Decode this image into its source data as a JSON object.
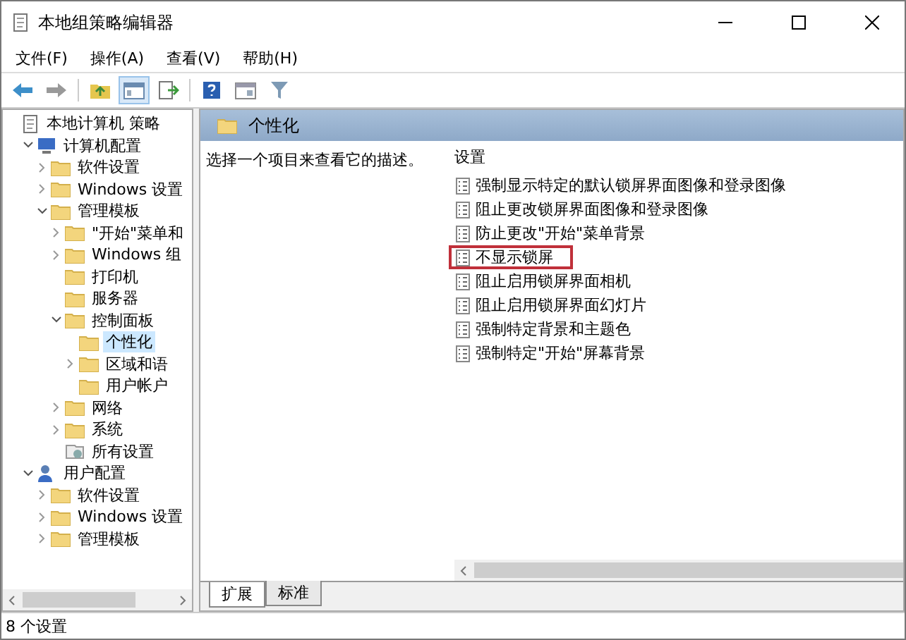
{
  "window": {
    "title": "本地组策略编辑器"
  },
  "menu": [
    "文件(F)",
    "操作(A)",
    "查看(V)",
    "帮助(H)"
  ],
  "toolbar": [
    {
      "kind": "back"
    },
    {
      "kind": "forward"
    },
    {
      "kind": "up"
    },
    {
      "kind": "tree",
      "selected": true
    },
    {
      "kind": "export"
    },
    {
      "kind": "help"
    },
    {
      "kind": "pane"
    },
    {
      "kind": "filter"
    }
  ],
  "tree": [
    {
      "label": "本地计算机 策略",
      "kind": "policy",
      "selected": false,
      "children": [
        {
          "label": "计算机配置",
          "kind": "computer",
          "expandable": true,
          "expanded": true,
          "selected": false,
          "children": [
            {
              "label": "软件设置",
              "kind": "folder",
              "expandable": true,
              "expanded": false,
              "selected": false
            },
            {
              "label": "Windows 设置",
              "kind": "folder",
              "expandable": true,
              "expanded": false,
              "selected": false
            },
            {
              "label": "管理模板",
              "kind": "folder",
              "expandable": true,
              "expanded": true,
              "selected": false,
              "children": [
                {
                  "label": "\"开始\"菜单和",
                  "kind": "folder",
                  "expandable": true,
                  "expanded": false,
                  "selected": false
                },
                {
                  "label": "Windows 组",
                  "kind": "folder",
                  "expandable": true,
                  "expanded": false,
                  "selected": false
                },
                {
                  "label": "打印机",
                  "kind": "folder",
                  "expandable": false,
                  "expanded": false,
                  "selected": false
                },
                {
                  "label": "服务器",
                  "kind": "folder",
                  "expandable": false,
                  "expanded": false,
                  "selected": false
                },
                {
                  "label": "控制面板",
                  "kind": "folder",
                  "expandable": true,
                  "expanded": true,
                  "selected": false,
                  "children": [
                    {
                      "label": "个性化",
                      "kind": "folder",
                      "expandable": false,
                      "expanded": false,
                      "selected": true
                    },
                    {
                      "label": "区域和语",
                      "kind": "folder",
                      "expandable": true,
                      "expanded": false,
                      "selected": false
                    },
                    {
                      "label": "用户帐户",
                      "kind": "folder",
                      "expandable": false,
                      "expanded": false,
                      "selected": false
                    }
                  ]
                },
                {
                  "label": "网络",
                  "kind": "folder",
                  "expandable": true,
                  "expanded": false,
                  "selected": false
                },
                {
                  "label": "系统",
                  "kind": "folder",
                  "expandable": true,
                  "expanded": false,
                  "selected": false
                },
                {
                  "label": "所有设置",
                  "kind": "all",
                  "expandable": false,
                  "expanded": false,
                  "selected": false
                }
              ]
            }
          ]
        },
        {
          "label": "用户配置",
          "kind": "user",
          "expandable": true,
          "expanded": true,
          "selected": false,
          "children": [
            {
              "label": "软件设置",
              "kind": "folder",
              "expandable": true,
              "expanded": false,
              "selected": false
            },
            {
              "label": "Windows 设置",
              "kind": "folder",
              "expandable": true,
              "expanded": false,
              "selected": false
            },
            {
              "label": "管理模板",
              "kind": "folder",
              "expandable": true,
              "expanded": false,
              "selected": false
            }
          ]
        }
      ]
    }
  ],
  "details": {
    "header": "个性化",
    "description": "选择一个项目来查看它的描述。",
    "column": "设置",
    "settings": [
      {
        "label": "强制显示特定的默认锁屏界面图像和登录图像",
        "highlighted": false
      },
      {
        "label": "阻止更改锁屏界面图像和登录图像",
        "highlighted": false
      },
      {
        "label": "防止更改\"开始\"菜单背景",
        "highlighted": false
      },
      {
        "label": "不显示锁屏",
        "highlighted": true
      },
      {
        "label": "阻止启用锁屏界面相机",
        "highlighted": false
      },
      {
        "label": "阻止启用锁屏界面幻灯片",
        "highlighted": false
      },
      {
        "label": "强制特定背景和主题色",
        "highlighted": false
      },
      {
        "label": "强制特定\"开始\"屏幕背景",
        "highlighted": false
      }
    ],
    "tabs": [
      {
        "label": "扩展",
        "selected": true
      },
      {
        "label": "标准",
        "selected": false
      }
    ]
  },
  "status_bar": "8 个设置"
}
